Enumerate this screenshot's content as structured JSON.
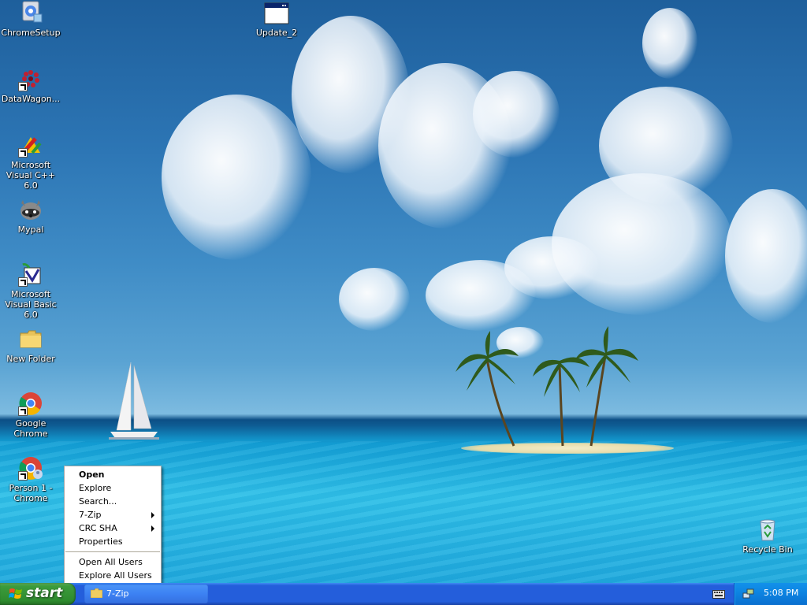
{
  "desktop": {
    "icons": [
      {
        "label": "ChromeSetup",
        "icon": "chrome-setup-icon"
      },
      {
        "label": "Update_2",
        "icon": "window-app-icon"
      },
      {
        "label": "DataWagon...",
        "icon": "datawagon-icon"
      },
      {
        "label": "Microsoft Visual C++ 6.0",
        "icon": "visual-cpp-icon"
      },
      {
        "label": "Mypal",
        "icon": "mypal-icon"
      },
      {
        "label": "Microsoft Visual Basic 6.0",
        "icon": "visual-basic-icon"
      },
      {
        "label": "New Folder",
        "icon": "folder-icon"
      },
      {
        "label": "Google Chrome",
        "icon": "chrome-icon"
      },
      {
        "label": "Person 1 - Chrome",
        "icon": "chrome-profile-icon"
      },
      {
        "label": "Recycle Bin",
        "icon": "recycle-bin-icon"
      }
    ]
  },
  "context_menu": {
    "items": [
      {
        "label": "Open",
        "default": true
      },
      {
        "label": "Explore"
      },
      {
        "label": "Search..."
      },
      {
        "label": "7-Zip",
        "submenu": true
      },
      {
        "label": "CRC SHA",
        "submenu": true
      },
      {
        "label": "Properties"
      },
      {
        "label": "Open All Users"
      },
      {
        "label": "Explore All Users"
      }
    ]
  },
  "taskbar": {
    "start_label": "start",
    "task_label": "7-Zip",
    "clock": "5:08 PM"
  },
  "colors": {
    "taskbar_blue": "#245edb",
    "start_green": "#3c9b3c",
    "tray_blue": "#0c82e0",
    "menu_separator": "#aca899"
  }
}
